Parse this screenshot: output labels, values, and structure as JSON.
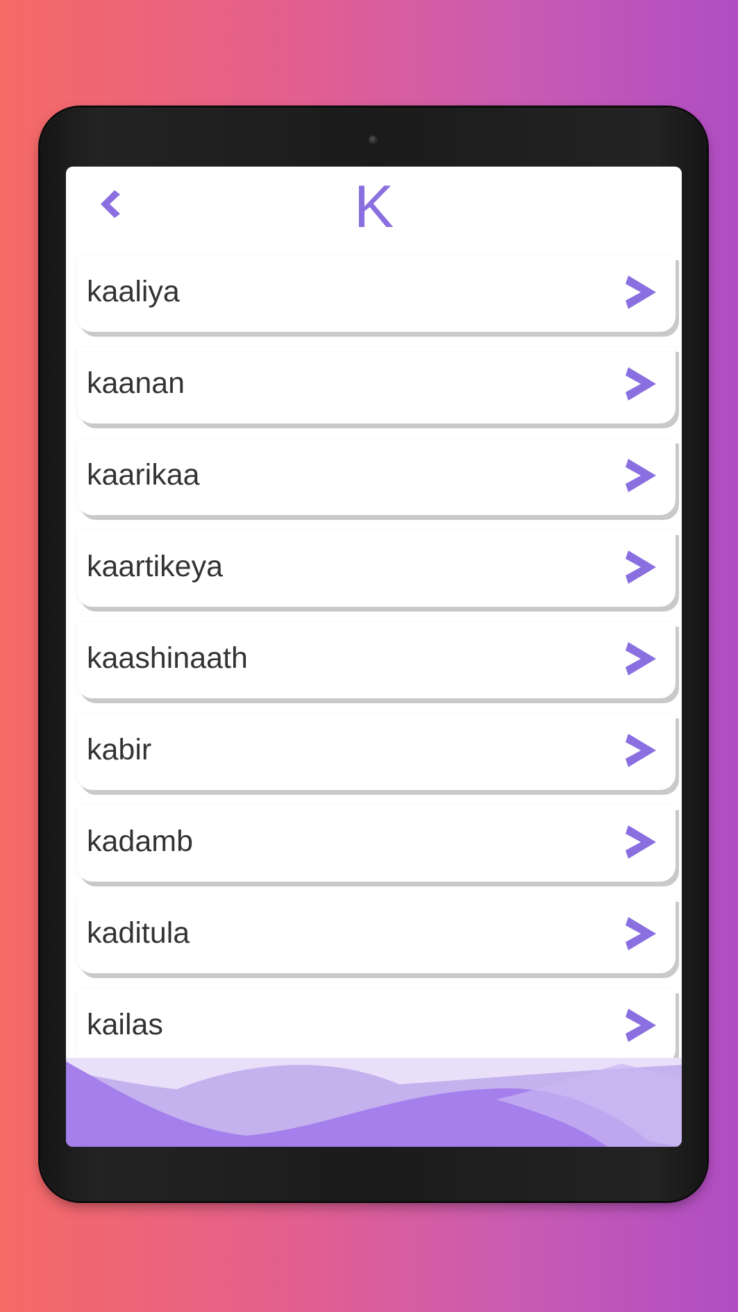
{
  "header": {
    "title": "K"
  },
  "names": [
    "kaaliya",
    "kaanan",
    "kaarikaa",
    "kaartikeya",
    "kaashinaath",
    "kabir",
    "kadamb",
    "kaditula",
    "kailas"
  ],
  "icons": {
    "back": "chevron-left-icon",
    "item_arrow": "chevron-right-icon"
  },
  "colors": {
    "accent": "#8a6fe0",
    "text": "#333333",
    "background_start": "#f66a65",
    "background_end": "#b04dc4"
  }
}
